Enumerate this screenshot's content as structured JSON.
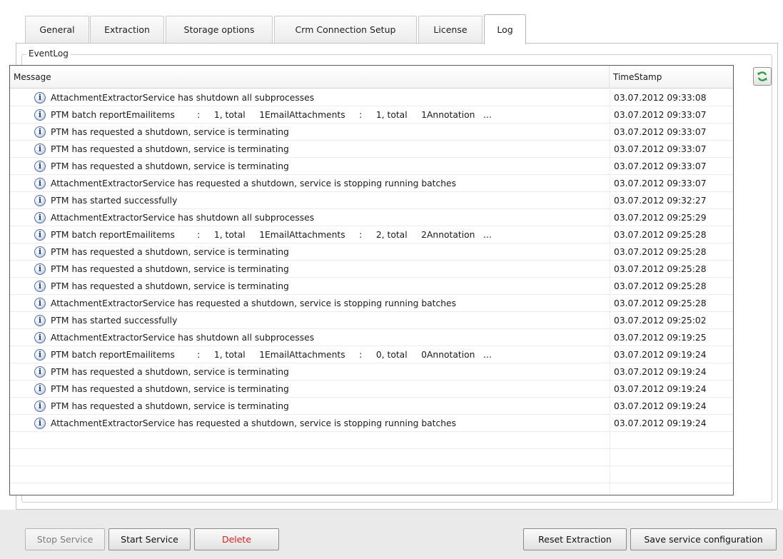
{
  "tabs": [
    {
      "label": "General"
    },
    {
      "label": "Extraction"
    },
    {
      "label": "Storage options"
    },
    {
      "label": "Crm Connection Setup"
    },
    {
      "label": "License"
    },
    {
      "label": "Log",
      "active": true
    }
  ],
  "eventlog": {
    "group_label": "EventLog",
    "columns": {
      "message": "Message",
      "timestamp": "TimeStamp"
    },
    "refresh_icon": "refresh-icon",
    "row_icon": "info-icon",
    "rows": [
      {
        "message": "AttachmentExtractorService has shutdown all subprocesses",
        "timestamp": "03.07.2012 09:33:08"
      },
      {
        "message": "PTM batch reportEmailitems        :     1, total     1EmailAttachments     :     1, total     1Annotation   ...",
        "timestamp": "03.07.2012 09:33:07"
      },
      {
        "message": "PTM has requested a shutdown, service is terminating",
        "timestamp": "03.07.2012 09:33:07"
      },
      {
        "message": "PTM has requested a shutdown, service is terminating",
        "timestamp": "03.07.2012 09:33:07"
      },
      {
        "message": "PTM has requested a shutdown, service is terminating",
        "timestamp": "03.07.2012 09:33:07"
      },
      {
        "message": "AttachmentExtractorService has requested a shutdown, service is stopping running batches",
        "timestamp": "03.07.2012 09:33:07"
      },
      {
        "message": "PTM has started successfully",
        "timestamp": "03.07.2012 09:32:27"
      },
      {
        "message": "AttachmentExtractorService has shutdown all subprocesses",
        "timestamp": "03.07.2012 09:25:29"
      },
      {
        "message": "PTM batch reportEmailitems        :     1, total     1EmailAttachments     :     2, total     2Annotation   ...",
        "timestamp": "03.07.2012 09:25:28"
      },
      {
        "message": "PTM has requested a shutdown, service is terminating",
        "timestamp": "03.07.2012 09:25:28"
      },
      {
        "message": "PTM has requested a shutdown, service is terminating",
        "timestamp": "03.07.2012 09:25:28"
      },
      {
        "message": "PTM has requested a shutdown, service is terminating",
        "timestamp": "03.07.2012 09:25:28"
      },
      {
        "message": "AttachmentExtractorService has requested a shutdown, service is stopping running batches",
        "timestamp": "03.07.2012 09:25:28"
      },
      {
        "message": "PTM has started successfully",
        "timestamp": "03.07.2012 09:25:02"
      },
      {
        "message": "AttachmentExtractorService has shutdown all subprocesses",
        "timestamp": "03.07.2012 09:19:25"
      },
      {
        "message": "PTM batch reportEmailitems        :     1, total     1EmailAttachments     :     0, total     0Annotation   ...",
        "timestamp": "03.07.2012 09:19:24"
      },
      {
        "message": "PTM has requested a shutdown, service is terminating",
        "timestamp": "03.07.2012 09:19:24"
      },
      {
        "message": "PTM has requested a shutdown, service is terminating",
        "timestamp": "03.07.2012 09:19:24"
      },
      {
        "message": "PTM has requested a shutdown, service is terminating",
        "timestamp": "03.07.2012 09:19:24"
      },
      {
        "message": "AttachmentExtractorService has requested a shutdown, service is stopping running batches",
        "timestamp": "03.07.2012 09:19:24"
      }
    ]
  },
  "buttons": {
    "stop_service": "Stop Service",
    "start_service": "Start Service",
    "delete": "Delete",
    "reset_extraction": "Reset Extraction",
    "save_config": "Save service configuration"
  },
  "colors": {
    "delete_text": "#e02020",
    "refresh_icon": "#2f9d3a"
  }
}
